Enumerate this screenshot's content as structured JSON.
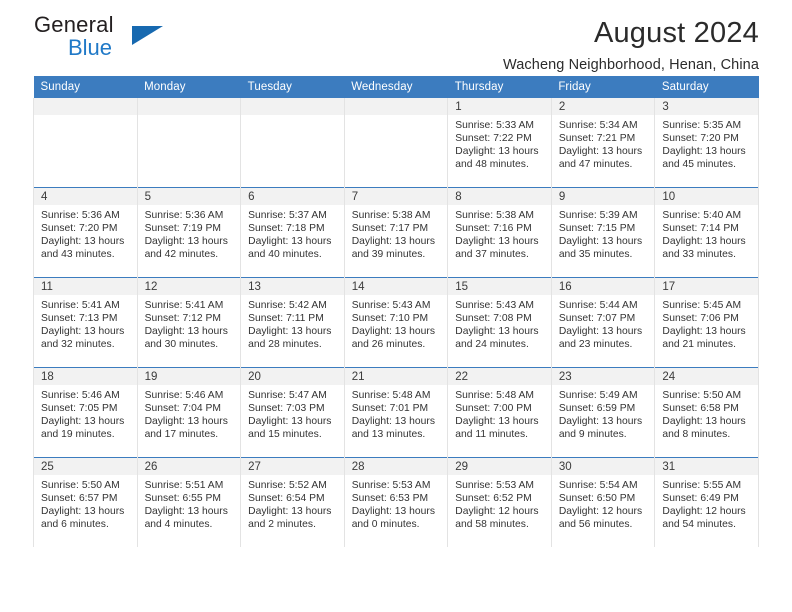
{
  "brand": {
    "name_top": "General",
    "name_bottom": "Blue",
    "accent_color": "#2079c7",
    "triangle_color": "#1769b0"
  },
  "header": {
    "title": "August 2024",
    "subtitle": "Wacheng Neighborhood, Henan, China"
  },
  "calendar": {
    "header_bg": "#3c7cbf",
    "daynum_bg": "#f2f2f2",
    "weekday_headers": [
      "Sunday",
      "Monday",
      "Tuesday",
      "Wednesday",
      "Thursday",
      "Friday",
      "Saturday"
    ],
    "labels": {
      "sunrise": "Sunrise:",
      "sunset": "Sunset:",
      "daylight": "Daylight:"
    },
    "weeks": [
      [
        {
          "day": "",
          "sunrise": "",
          "sunset": "",
          "daylight_line1": "",
          "daylight_line2": ""
        },
        {
          "day": "",
          "sunrise": "",
          "sunset": "",
          "daylight_line1": "",
          "daylight_line2": ""
        },
        {
          "day": "",
          "sunrise": "",
          "sunset": "",
          "daylight_line1": "",
          "daylight_line2": ""
        },
        {
          "day": "",
          "sunrise": "",
          "sunset": "",
          "daylight_line1": "",
          "daylight_line2": ""
        },
        {
          "day": "1",
          "sunrise": "Sunrise: 5:33 AM",
          "sunset": "Sunset: 7:22 PM",
          "daylight_line1": "Daylight: 13 hours",
          "daylight_line2": "and 48 minutes."
        },
        {
          "day": "2",
          "sunrise": "Sunrise: 5:34 AM",
          "sunset": "Sunset: 7:21 PM",
          "daylight_line1": "Daylight: 13 hours",
          "daylight_line2": "and 47 minutes."
        },
        {
          "day": "3",
          "sunrise": "Sunrise: 5:35 AM",
          "sunset": "Sunset: 7:20 PM",
          "daylight_line1": "Daylight: 13 hours",
          "daylight_line2": "and 45 minutes."
        }
      ],
      [
        {
          "day": "4",
          "sunrise": "Sunrise: 5:36 AM",
          "sunset": "Sunset: 7:20 PM",
          "daylight_line1": "Daylight: 13 hours",
          "daylight_line2": "and 43 minutes."
        },
        {
          "day": "5",
          "sunrise": "Sunrise: 5:36 AM",
          "sunset": "Sunset: 7:19 PM",
          "daylight_line1": "Daylight: 13 hours",
          "daylight_line2": "and 42 minutes."
        },
        {
          "day": "6",
          "sunrise": "Sunrise: 5:37 AM",
          "sunset": "Sunset: 7:18 PM",
          "daylight_line1": "Daylight: 13 hours",
          "daylight_line2": "and 40 minutes."
        },
        {
          "day": "7",
          "sunrise": "Sunrise: 5:38 AM",
          "sunset": "Sunset: 7:17 PM",
          "daylight_line1": "Daylight: 13 hours",
          "daylight_line2": "and 39 minutes."
        },
        {
          "day": "8",
          "sunrise": "Sunrise: 5:38 AM",
          "sunset": "Sunset: 7:16 PM",
          "daylight_line1": "Daylight: 13 hours",
          "daylight_line2": "and 37 minutes."
        },
        {
          "day": "9",
          "sunrise": "Sunrise: 5:39 AM",
          "sunset": "Sunset: 7:15 PM",
          "daylight_line1": "Daylight: 13 hours",
          "daylight_line2": "and 35 minutes."
        },
        {
          "day": "10",
          "sunrise": "Sunrise: 5:40 AM",
          "sunset": "Sunset: 7:14 PM",
          "daylight_line1": "Daylight: 13 hours",
          "daylight_line2": "and 33 minutes."
        }
      ],
      [
        {
          "day": "11",
          "sunrise": "Sunrise: 5:41 AM",
          "sunset": "Sunset: 7:13 PM",
          "daylight_line1": "Daylight: 13 hours",
          "daylight_line2": "and 32 minutes."
        },
        {
          "day": "12",
          "sunrise": "Sunrise: 5:41 AM",
          "sunset": "Sunset: 7:12 PM",
          "daylight_line1": "Daylight: 13 hours",
          "daylight_line2": "and 30 minutes."
        },
        {
          "day": "13",
          "sunrise": "Sunrise: 5:42 AM",
          "sunset": "Sunset: 7:11 PM",
          "daylight_line1": "Daylight: 13 hours",
          "daylight_line2": "and 28 minutes."
        },
        {
          "day": "14",
          "sunrise": "Sunrise: 5:43 AM",
          "sunset": "Sunset: 7:10 PM",
          "daylight_line1": "Daylight: 13 hours",
          "daylight_line2": "and 26 minutes."
        },
        {
          "day": "15",
          "sunrise": "Sunrise: 5:43 AM",
          "sunset": "Sunset: 7:08 PM",
          "daylight_line1": "Daylight: 13 hours",
          "daylight_line2": "and 24 minutes."
        },
        {
          "day": "16",
          "sunrise": "Sunrise: 5:44 AM",
          "sunset": "Sunset: 7:07 PM",
          "daylight_line1": "Daylight: 13 hours",
          "daylight_line2": "and 23 minutes."
        },
        {
          "day": "17",
          "sunrise": "Sunrise: 5:45 AM",
          "sunset": "Sunset: 7:06 PM",
          "daylight_line1": "Daylight: 13 hours",
          "daylight_line2": "and 21 minutes."
        }
      ],
      [
        {
          "day": "18",
          "sunrise": "Sunrise: 5:46 AM",
          "sunset": "Sunset: 7:05 PM",
          "daylight_line1": "Daylight: 13 hours",
          "daylight_line2": "and 19 minutes."
        },
        {
          "day": "19",
          "sunrise": "Sunrise: 5:46 AM",
          "sunset": "Sunset: 7:04 PM",
          "daylight_line1": "Daylight: 13 hours",
          "daylight_line2": "and 17 minutes."
        },
        {
          "day": "20",
          "sunrise": "Sunrise: 5:47 AM",
          "sunset": "Sunset: 7:03 PM",
          "daylight_line1": "Daylight: 13 hours",
          "daylight_line2": "and 15 minutes."
        },
        {
          "day": "21",
          "sunrise": "Sunrise: 5:48 AM",
          "sunset": "Sunset: 7:01 PM",
          "daylight_line1": "Daylight: 13 hours",
          "daylight_line2": "and 13 minutes."
        },
        {
          "day": "22",
          "sunrise": "Sunrise: 5:48 AM",
          "sunset": "Sunset: 7:00 PM",
          "daylight_line1": "Daylight: 13 hours",
          "daylight_line2": "and 11 minutes."
        },
        {
          "day": "23",
          "sunrise": "Sunrise: 5:49 AM",
          "sunset": "Sunset: 6:59 PM",
          "daylight_line1": "Daylight: 13 hours",
          "daylight_line2": "and 9 minutes."
        },
        {
          "day": "24",
          "sunrise": "Sunrise: 5:50 AM",
          "sunset": "Sunset: 6:58 PM",
          "daylight_line1": "Daylight: 13 hours",
          "daylight_line2": "and 8 minutes."
        }
      ],
      [
        {
          "day": "25",
          "sunrise": "Sunrise: 5:50 AM",
          "sunset": "Sunset: 6:57 PM",
          "daylight_line1": "Daylight: 13 hours",
          "daylight_line2": "and 6 minutes."
        },
        {
          "day": "26",
          "sunrise": "Sunrise: 5:51 AM",
          "sunset": "Sunset: 6:55 PM",
          "daylight_line1": "Daylight: 13 hours",
          "daylight_line2": "and 4 minutes."
        },
        {
          "day": "27",
          "sunrise": "Sunrise: 5:52 AM",
          "sunset": "Sunset: 6:54 PM",
          "daylight_line1": "Daylight: 13 hours",
          "daylight_line2": "and 2 minutes."
        },
        {
          "day": "28",
          "sunrise": "Sunrise: 5:53 AM",
          "sunset": "Sunset: 6:53 PM",
          "daylight_line1": "Daylight: 13 hours",
          "daylight_line2": "and 0 minutes."
        },
        {
          "day": "29",
          "sunrise": "Sunrise: 5:53 AM",
          "sunset": "Sunset: 6:52 PM",
          "daylight_line1": "Daylight: 12 hours",
          "daylight_line2": "and 58 minutes."
        },
        {
          "day": "30",
          "sunrise": "Sunrise: 5:54 AM",
          "sunset": "Sunset: 6:50 PM",
          "daylight_line1": "Daylight: 12 hours",
          "daylight_line2": "and 56 minutes."
        },
        {
          "day": "31",
          "sunrise": "Sunrise: 5:55 AM",
          "sunset": "Sunset: 6:49 PM",
          "daylight_line1": "Daylight: 12 hours",
          "daylight_line2": "and 54 minutes."
        }
      ]
    ]
  }
}
